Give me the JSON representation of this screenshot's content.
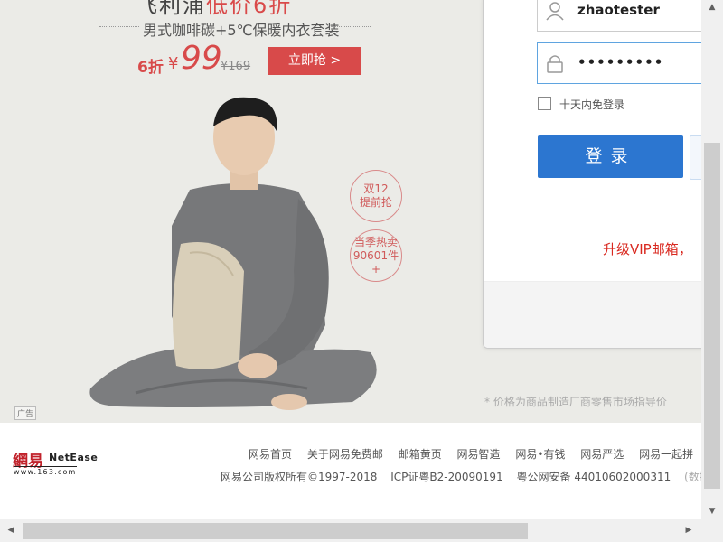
{
  "banner": {
    "headline_left": "飞利浦",
    "headline_right": "低价6折",
    "subtitle": "男式咖啡碳+5℃保暖内衣套装",
    "discount": "6折",
    "currency": "¥",
    "price": "99",
    "old_price": "¥169",
    "buy_label": "立即抢 >",
    "badge1_line1": "双12",
    "badge1_line2": "提前抢",
    "badge2_line1": "当季热卖",
    "badge2_line2": "90601件+",
    "ad_tag": "广告",
    "price_note": "* 价格为商品制造厂商零售市场指导价"
  },
  "login": {
    "username": "zhaotester",
    "password_mask": "•••••••••",
    "remember_label": "十天内免登录",
    "login_label": "登录",
    "vip_text": "升级VIP邮箱，"
  },
  "footer": {
    "logo_cn": "網易",
    "logo_en": "NetEase",
    "logo_url": "www.163.com",
    "links": [
      "网易首页",
      "关于网易免费邮",
      "邮箱黄页",
      "网易智造",
      "网易•有钱",
      "网易严选",
      "网易一起拼"
    ],
    "copyright": "网易公司版权所有©1997-2018",
    "icp": "ICP证粤B2-20090191",
    "police": "粤公网安备 44010602000311",
    "data_source": "(数据来源"
  },
  "colors": {
    "accent_red": "#d84a4a",
    "login_blue": "#2c76d0",
    "vip_red": "#d9281f"
  }
}
